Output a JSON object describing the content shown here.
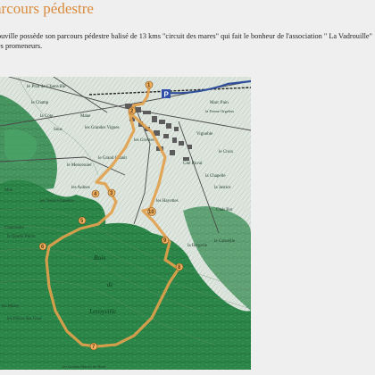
{
  "page": {
    "title": "arcours pédestre",
    "intro_line1": "ouville possède son parcours pédestre balisé de 13 kms \"circuit des mares\" qui fait le bonheur de l'association \" La Vadrouille\"",
    "intro_line2": "es promeneurs."
  },
  "map": {
    "parking_badge": "P",
    "places": [
      "le Prat de Chenville",
      "la Cote",
      "Marc Pain",
      "les Grandes Vignes",
      "les Griettes",
      "le Grand Chanit",
      "Cité Ruval",
      "le Menorsuier",
      "les Voies Chanteuz",
      "les Hayottes",
      "Bois",
      "de",
      "Leroyville",
      "la Bergerie",
      "la Quarte Pierre",
      "Chaussette",
      "les Grands Marais de Bonc",
      "la Chapelle",
      "la Justice",
      "Clair Bot",
      "la Ferme Orgelets",
      "Mane",
      "Mue",
      "les Mares",
      "Sous",
      "le Champ",
      "les Aulnes",
      "les Pièces des Gros",
      "le Croix",
      "Vignoble",
      "le Carneille"
    ],
    "waypoints": [
      "1",
      "2",
      "3",
      "4",
      "5",
      "6",
      "7",
      "8",
      "9",
      "10"
    ],
    "colors": {
      "forest": "#2f8a4a",
      "route": "#e2a14d",
      "waypoint": "#f0b060"
    }
  }
}
